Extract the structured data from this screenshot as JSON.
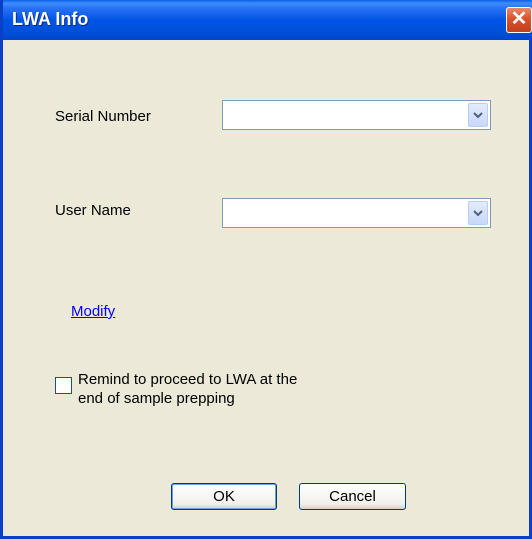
{
  "window": {
    "title": "LWA Info",
    "close_glyph": "✕"
  },
  "form": {
    "serial_number": {
      "label": "Serial Number",
      "value": ""
    },
    "user_name": {
      "label": "User Name",
      "value": ""
    },
    "modify_link": "Modify",
    "remind_checkbox": {
      "label_line1": "Remind to proceed to LWA at the",
      "label_line2": "end of sample prepping",
      "checked": false
    }
  },
  "buttons": {
    "ok": "OK",
    "cancel": "Cancel"
  }
}
